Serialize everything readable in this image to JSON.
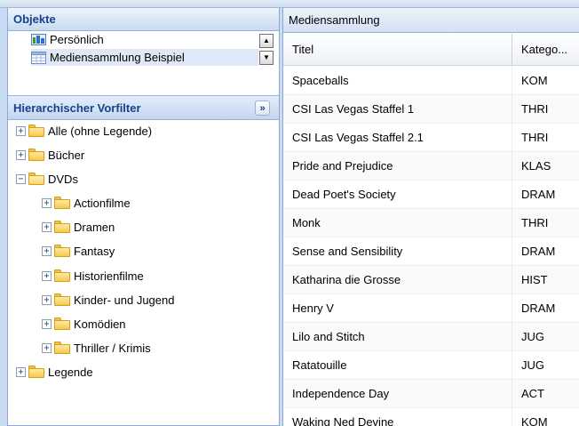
{
  "objects_panel": {
    "title": "Objekte",
    "items": [
      {
        "label": "Persönlich",
        "icon": "database-icon"
      },
      {
        "label": "Mediensammlung Beispiel",
        "icon": "table-icon",
        "selected": true
      }
    ]
  },
  "filter_panel": {
    "title": "Hierarchischer Vorfilter",
    "tree": [
      {
        "label": "Alle (ohne Legende)",
        "level": 0,
        "expanded": false
      },
      {
        "label": "Bücher",
        "level": 0,
        "expanded": false
      },
      {
        "label": "DVDs",
        "level": 0,
        "expanded": true
      },
      {
        "label": "Actionfilme",
        "level": 1,
        "expanded": false
      },
      {
        "label": "Dramen",
        "level": 1,
        "expanded": false
      },
      {
        "label": "Fantasy",
        "level": 1,
        "expanded": false
      },
      {
        "label": "Historienfilme",
        "level": 1,
        "expanded": false
      },
      {
        "label": "Kinder- und Jugend",
        "level": 1,
        "expanded": false
      },
      {
        "label": "Komödien",
        "level": 1,
        "expanded": false
      },
      {
        "label": "Thriller / Krimis",
        "level": 1,
        "expanded": false
      },
      {
        "label": "Legende",
        "level": 0,
        "expanded": false
      }
    ]
  },
  "media_panel": {
    "title": "Mediensammlung",
    "columns": [
      "Titel",
      "Katego..."
    ],
    "rows": [
      [
        "Spaceballs",
        "KOM"
      ],
      [
        "CSI Las Vegas Staffel 1",
        "THRI"
      ],
      [
        "CSI Las Vegas Staffel 2.1",
        "THRI"
      ],
      [
        "Pride and Prejudice",
        "KLAS"
      ],
      [
        "Dead Poet's Society",
        "DRAM"
      ],
      [
        "Monk",
        "THRI"
      ],
      [
        "Sense and Sensibility",
        "DRAM"
      ],
      [
        "Katharina die Grosse",
        "HIST"
      ],
      [
        "Henry V",
        "DRAM"
      ],
      [
        "Lilo and Stitch",
        "JUG"
      ],
      [
        "Ratatouille",
        "JUG"
      ],
      [
        "Independence Day",
        "ACT"
      ],
      [
        "Waking Ned Devine",
        "KOM"
      ]
    ]
  }
}
